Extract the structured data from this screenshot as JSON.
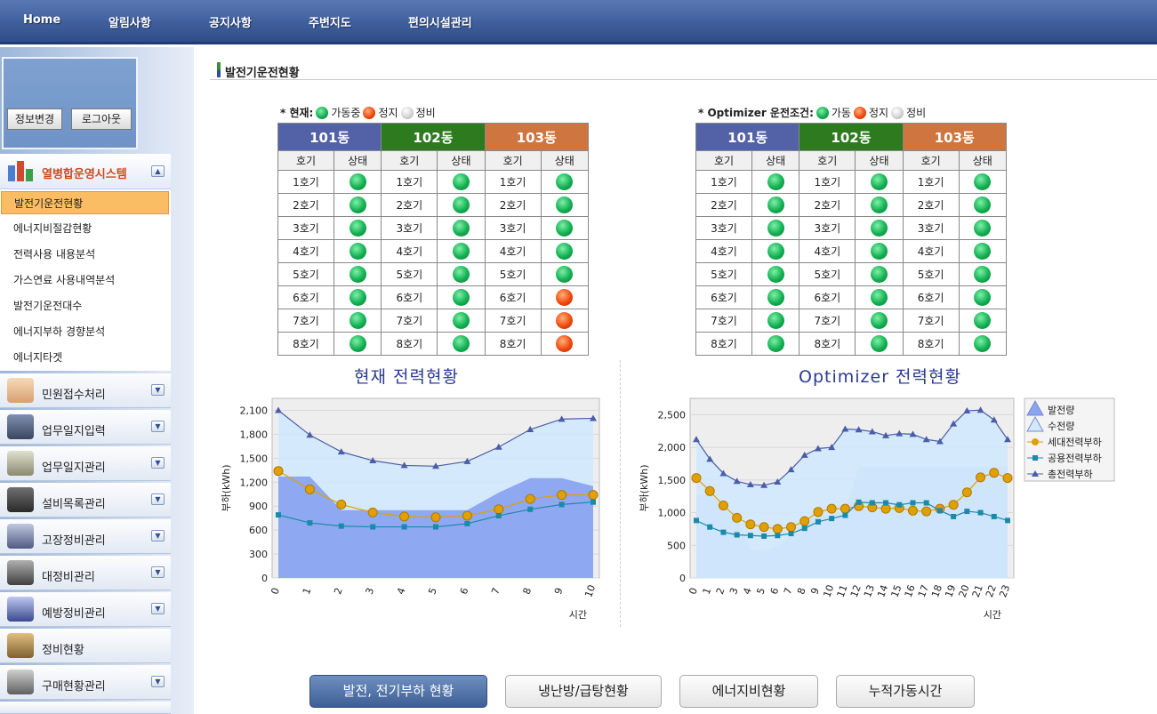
{
  "topnav": {
    "items": [
      "Home",
      "알림사항",
      "공지사항",
      "주변지도",
      "편의시설관리"
    ]
  },
  "login": {
    "edit_label": "정보변경",
    "logout_label": "로그아웃"
  },
  "system": {
    "title": "열병합운영시스템"
  },
  "submenu": [
    "발전기운전현황",
    "에너지비절감현황",
    "전력사용 내용분석",
    "가스연료 사용내역분석",
    "발전기운전대수",
    "에너지부하 경향분석",
    "에너지타겟"
  ],
  "menus": [
    "민원접수처리",
    "업무일지입력",
    "업무일지관리",
    "설비목록관리",
    "고장정비관리",
    "대정비관리",
    "예방정비관리",
    "정비현황",
    "구매현황관리"
  ],
  "page": {
    "title": "발전기운전현황"
  },
  "left_status": {
    "legend_title": "* 현재:",
    "legend_items": [
      "가동중",
      "정지",
      "정비"
    ],
    "buildings": [
      "101동",
      "102동",
      "103동"
    ],
    "col_headers": [
      "호기",
      "상태"
    ],
    "units": [
      "1호기",
      "2호기",
      "3호기",
      "4호기",
      "5호기",
      "6호기",
      "7호기",
      "8호기"
    ],
    "states": [
      [
        "green",
        "green",
        "green",
        "green",
        "green",
        "green",
        "green",
        "green"
      ],
      [
        "green",
        "green",
        "green",
        "green",
        "green",
        "green",
        "green",
        "green"
      ],
      [
        "green",
        "green",
        "green",
        "green",
        "green",
        "red",
        "red",
        "red"
      ]
    ]
  },
  "right_status": {
    "legend_title": "* Optimizer 운전조건:",
    "legend_items": [
      "가동",
      "정지",
      "정비"
    ],
    "buildings": [
      "101동",
      "102동",
      "103동"
    ],
    "col_headers": [
      "호기",
      "상태"
    ],
    "units": [
      "1호기",
      "2호기",
      "3호기",
      "4호기",
      "5호기",
      "6호기",
      "7호기",
      "8호기"
    ],
    "states": [
      [
        "green",
        "green",
        "green",
        "green",
        "green",
        "green",
        "green",
        "green"
      ],
      [
        "green",
        "green",
        "green",
        "green",
        "green",
        "green",
        "green",
        "green"
      ],
      [
        "green",
        "green",
        "green",
        "green",
        "green",
        "green",
        "green",
        "green"
      ]
    ]
  },
  "chart_data": [
    {
      "type": "area",
      "title": "현재 전력현황",
      "xlabel": "시간",
      "ylabel": "부하(kWh)",
      "ylim": [
        0,
        2250
      ],
      "yticks": [
        "0",
        "300",
        "600",
        "900",
        "1,200",
        "1,500",
        "1,800",
        "2,100"
      ],
      "x": [
        0,
        1,
        2,
        3,
        4,
        5,
        6,
        7,
        8,
        9,
        10
      ],
      "series": [
        {
          "name": "수전량",
          "kind": "area",
          "color": "#d2e8fb",
          "values": [
            2100,
            1790,
            1580,
            1470,
            1410,
            1400,
            1460,
            1640,
            1860,
            1990,
            2000
          ]
        },
        {
          "name": "발전량",
          "kind": "area",
          "color": "#8aa4f0",
          "values": [
            1270,
            1270,
            850,
            850,
            850,
            850,
            850,
            1070,
            1250,
            1250,
            1150
          ]
        },
        {
          "name": "세대전력부하",
          "kind": "line",
          "color": "#e0a000",
          "values": [
            1340,
            1110,
            920,
            820,
            770,
            760,
            780,
            860,
            990,
            1040,
            1040
          ]
        },
        {
          "name": "공용전력부하",
          "kind": "line",
          "color": "#1a8aaa",
          "values": [
            790,
            690,
            650,
            640,
            640,
            640,
            680,
            780,
            860,
            920,
            950
          ]
        },
        {
          "name": "총전력부하",
          "kind": "line",
          "color": "#4a5ea8",
          "values": [
            2100,
            1790,
            1580,
            1470,
            1410,
            1400,
            1460,
            1640,
            1860,
            1990,
            2000
          ]
        }
      ]
    },
    {
      "type": "area",
      "title": "Optimizer 전력현황",
      "xlabel": "시간",
      "ylabel": "부하(kWh)",
      "ylim": [
        0,
        2750
      ],
      "yticks": [
        "0",
        "500",
        "1,000",
        "1,500",
        "2,000",
        "2,500"
      ],
      "x": [
        0,
        1,
        2,
        3,
        4,
        5,
        6,
        7,
        8,
        9,
        10,
        11,
        12,
        13,
        14,
        15,
        16,
        17,
        18,
        19,
        20,
        21,
        22,
        23
      ],
      "legend_position": "right",
      "series": [
        {
          "name": "발전량",
          "kind": "area",
          "color": "#8aa4f0",
          "values": [
            1270,
            1270,
            1080,
            900,
            430,
            430,
            480,
            650,
            900,
            960,
            960,
            1050,
            1700,
            1700,
            1700,
            1700,
            1700,
            1700,
            1700,
            1700,
            1700,
            1700,
            1700,
            1700
          ]
        },
        {
          "name": "수전량",
          "kind": "area",
          "color": "#d2e8fb",
          "values": [
            2120,
            1820,
            1600,
            1480,
            1430,
            1420,
            1470,
            1660,
            1880,
            1980,
            2000,
            2280,
            2270,
            2240,
            2180,
            2210,
            2200,
            2120,
            2090,
            2360,
            2560,
            2570,
            2420,
            2120
          ]
        },
        {
          "name": "세대전력부하",
          "kind": "line",
          "color": "#e0a000",
          "values": [
            1530,
            1330,
            1110,
            920,
            820,
            780,
            750,
            780,
            870,
            1010,
            1060,
            1060,
            1100,
            1080,
            1060,
            1070,
            1030,
            1020,
            1060,
            1120,
            1310,
            1540,
            1610,
            1530
          ]
        },
        {
          "name": "공용전력부하",
          "kind": "line",
          "color": "#1a8aaa",
          "values": [
            880,
            780,
            700,
            660,
            650,
            640,
            650,
            680,
            760,
            860,
            910,
            960,
            1160,
            1150,
            1150,
            1120,
            1150,
            1150,
            1030,
            940,
            1020,
            1000,
            940,
            880
          ]
        },
        {
          "name": "총전력부하",
          "kind": "line",
          "color": "#4a5ea8",
          "values": [
            2120,
            1820,
            1600,
            1480,
            1430,
            1420,
            1470,
            1660,
            1880,
            1980,
            2000,
            2280,
            2270,
            2240,
            2180,
            2210,
            2200,
            2120,
            2090,
            2360,
            2560,
            2570,
            2420,
            2120
          ]
        }
      ]
    }
  ],
  "buttons": [
    "발전, 전기부하 현황",
    "냉난방/급탕현황",
    "에너지비현황",
    "누적가동시간"
  ]
}
